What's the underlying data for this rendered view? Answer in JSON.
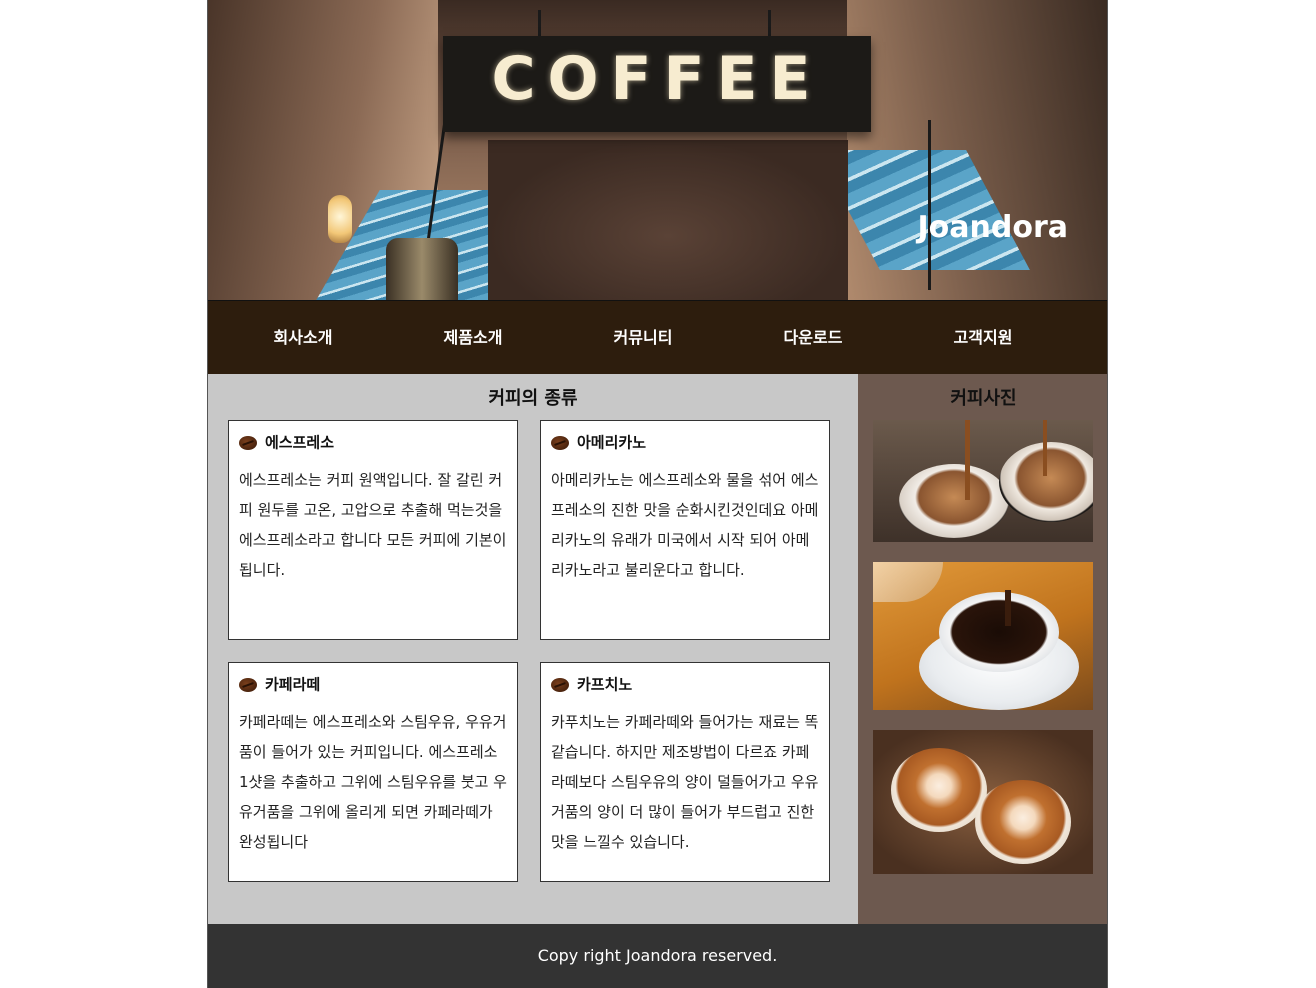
{
  "header": {
    "sign_text": "COFFEE",
    "brand": "Joandora"
  },
  "nav": {
    "items": [
      {
        "label": "회사소개"
      },
      {
        "label": "제품소개"
      },
      {
        "label": "커뮤니티"
      },
      {
        "label": "다운로드"
      },
      {
        "label": "고객지원"
      }
    ]
  },
  "main": {
    "title": "커피의 종류",
    "cards": [
      {
        "title": "에스프레소",
        "icon": "coffee-bean-icon",
        "body": "에스프레소는 커피 원액입니다. 잘 갈린 커피 원두를 고온, 고압으로 추출해 먹는것을 에스프레소라고 합니다 모든 커피에 기본이 됩니다."
      },
      {
        "title": "아메리카노",
        "icon": "coffee-bean-icon",
        "body": "아메리카노는 에스프레소와 물을 섞어 에스프레소의 진한 맛을 순화시킨것인데요 아메리카노의 유래가 미국에서 시작 되어 아메리카노라고 불리운다고 합니다."
      },
      {
        "title": "카페라떼",
        "icon": "coffee-bean-icon",
        "body": "카페라떼는 에스프레소와 스팀우유, 우유거품이 들어가 있는 커피입니다. 에스프레소 1샷을 추출하고 그위에 스팀우유를 붓고 우유거품을 그위에 올리게 되면 카페라떼가 완성됩니다"
      },
      {
        "title": "카프치노",
        "icon": "coffee-bean-icon",
        "body": "카푸치노는 카페라떼와 들어가는 재료는 똑같습니다. 하지만 제조방법이 다르죠 카페라떼보다 스팀우유의 양이 덜들어가고 우유거품의 양이 더 많이 들어가 부드럽고 진한 맛을 느낄수 있습니다."
      }
    ]
  },
  "aside": {
    "title": "커피사진",
    "photos": [
      "espresso-machine-cups-photo",
      "pour-over-coffee-cup-photo",
      "latte-art-cups-photo"
    ]
  },
  "footer": {
    "text": "Copy right Joandora reserved."
  },
  "colors": {
    "nav_bg": "#2d1d0d",
    "main_bg": "#c8c8c8",
    "aside_bg": "#6d594f",
    "footer_bg": "#333333"
  }
}
